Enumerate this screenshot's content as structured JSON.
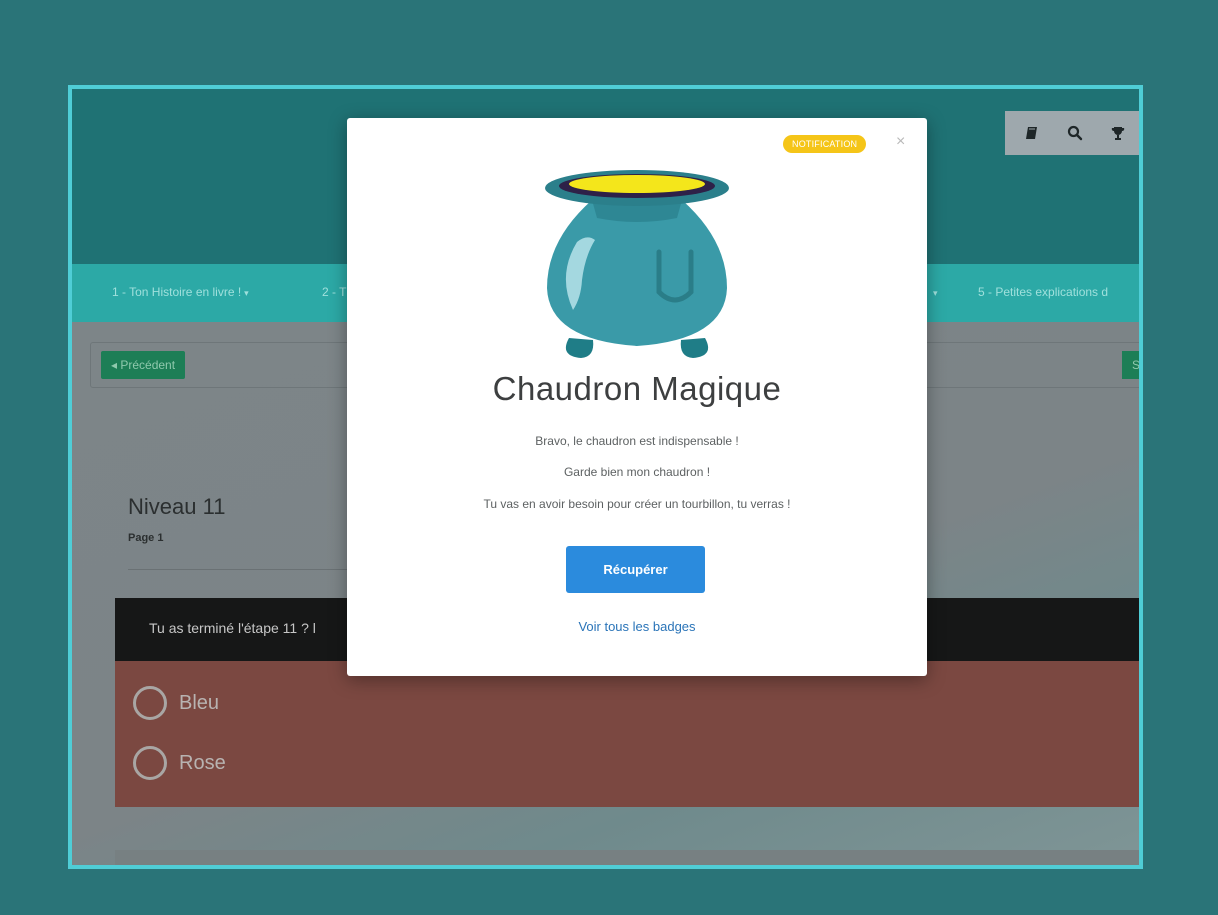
{
  "nav": {
    "items": [
      {
        "label": "1 - Ton Histoire en livre !"
      },
      {
        "label": "2 - T"
      },
      {
        "label": ""
      },
      {
        "label": "5 - Petites explications d"
      }
    ]
  },
  "header_icons": [
    "book-icon",
    "search-icon",
    "trophy-icon"
  ],
  "pager": {
    "prev_label": "◂ Précédent",
    "next_label": "Su"
  },
  "level": {
    "title": "Niveau 11",
    "page": "Page 1"
  },
  "question": {
    "text": "Tu as terminé l'étape 11 ? l",
    "answers": [
      {
        "label": "Bleu"
      },
      {
        "label": "Rose"
      }
    ]
  },
  "modal": {
    "badge": "NOTIFICATION",
    "close": "×",
    "title": "Chaudron Magique",
    "lines": [
      "Bravo, le chaudron est indispensable !",
      "Garde bien mon chaudron !",
      "Tu vas en avoir besoin pour créer un tourbillon, tu verras !"
    ],
    "button_label": "Récupérer",
    "link_label": "Voir tous les badges"
  },
  "colors": {
    "background": "#2a7478",
    "frame_border": "#4fcdd6",
    "navbar": "#2ca9a6",
    "badge": "#f5c518",
    "primary_button": "#2b8bdd",
    "cauldron": "#3a9aa8"
  }
}
